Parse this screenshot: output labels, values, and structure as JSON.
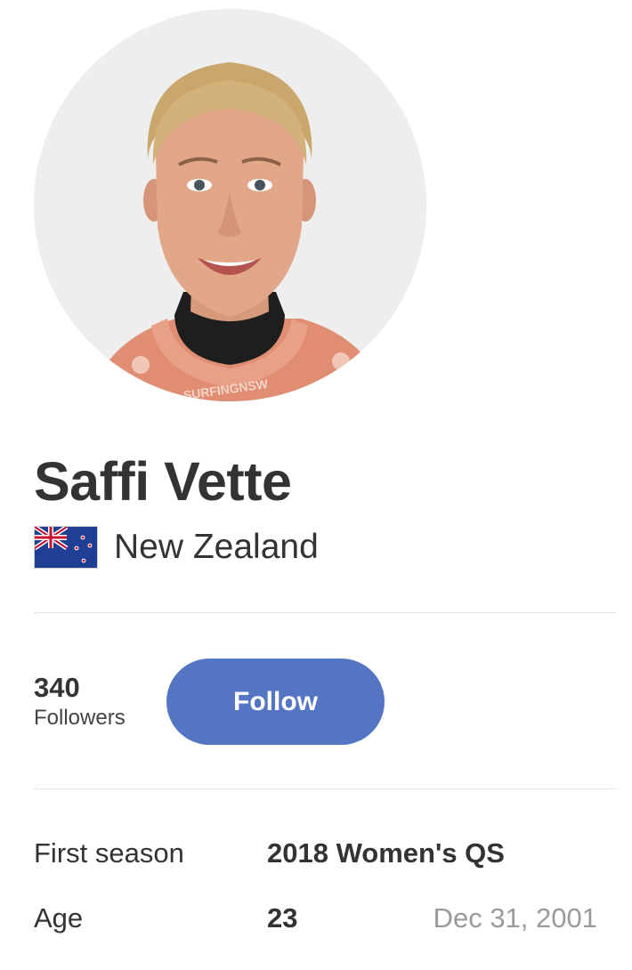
{
  "athlete": {
    "name": "Saffi Vette",
    "country": "New Zealand",
    "flag_icon": "new-zealand-flag-icon",
    "photo_jersey_text": "SURFINGNSW"
  },
  "social": {
    "followers_count": "340",
    "followers_label": "Followers",
    "follow_label": "Follow"
  },
  "details": {
    "first_season_label": "First season",
    "first_season_value": "2018 Women's QS",
    "age_label": "Age",
    "age_value": "23",
    "birth_date": "Dec 31, 2001"
  },
  "colors": {
    "follow_button": "#5474c4",
    "text_primary": "#333333",
    "text_muted": "#9a9a9a",
    "divider": "#e4e4e4",
    "avatar_background": "#eeeeee"
  }
}
